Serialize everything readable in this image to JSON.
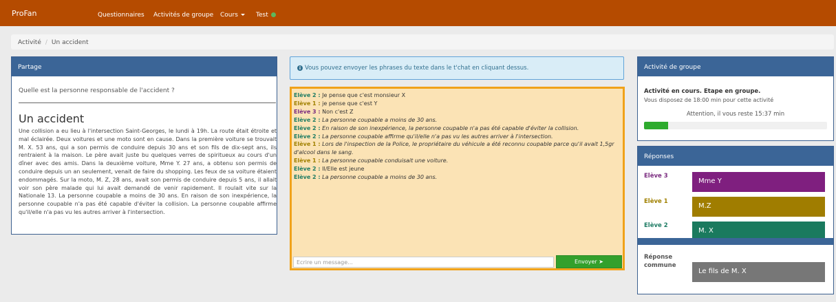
{
  "nav": {
    "brand": "ProFan",
    "items": [
      {
        "label": "Questionnaires"
      },
      {
        "label": "Activités de groupe"
      },
      {
        "label": "Cours"
      },
      {
        "label": "Test"
      }
    ]
  },
  "breadcrumb": {
    "root": "Activité",
    "current": "Un accident"
  },
  "partage": {
    "heading": "Partage",
    "question": "Quelle est la personne responsable de l'accident ?",
    "story_title": "Un accident",
    "story_text": "Une collision a eu lieu à l'intersection Saint-Georges, le lundi à 19h. La route était étroite et mal éclairée. Deux voitures et une moto sont en cause. Dans la première voiture se trouvait M. X. 53 ans, qui a son permis de conduire depuis 30 ans et son fils de dix-sept ans, ils rentraient à la maison. Le père avait juste bu quelques verres de spiritueux au cours d'un dîner avec des amis. Dans la deuxième voiture, Mme Y. 27 ans, a obtenu son permis de conduire depuis un an seulement, venait de faire du shopping. Les feux de sa voiture étaient endommagés. Sur la moto, M. Z, 28 ans, avait son permis de conduire depuis 5 ans, il allait voir son père malade qui lui avait demandé de venir rapidement. Il roulait vite sur la Nationale 13. La personne coupable a moins de 30 ans. En raison de son inexpérience, la personne coupable n'a pas été capable d'éviter la collision. La personne coupable affirme qu'il/elle n'a pas vu les autres arriver à l'intersection."
  },
  "info": {
    "text": "Vous pouvez envoyer les phrases du texte dans le t'chat en cliquant dessus."
  },
  "chat": {
    "messages": [
      {
        "speaker": "Elève 2 :",
        "text": "Je pense que c'est monsieur X",
        "italic": false,
        "color": "#1e7c64"
      },
      {
        "speaker": "Elève 1 :",
        "text": "je pense que c'est Y",
        "italic": false,
        "color": "#a08000"
      },
      {
        "speaker": "Elève 3 :",
        "text": "Non c'est Z",
        "italic": false,
        "color": "#7b2c80"
      },
      {
        "speaker": "Elève 2 :",
        "text": "La personne coupable a moins de 30 ans.",
        "italic": true,
        "color": "#1e7c64"
      },
      {
        "speaker": "Elève 2 :",
        "text": "En raison de son inexpérience, la personne coupable n'a pas été capable d'éviter la collision.",
        "italic": true,
        "color": "#1e7c64"
      },
      {
        "speaker": "Elève 2 :",
        "text": "La personne coupable affirme qu'il/elle n'a pas vu les autres arriver à l'intersection.",
        "italic": true,
        "color": "#1e7c64"
      },
      {
        "speaker": "Elève 1 :",
        "text": "Lors de l'inspection de la Police, le propriétaire du véhicule a été reconnu coupable parce qu'il avait 1,5gr d'alcool dans le sang.",
        "italic": true,
        "color": "#a08000"
      },
      {
        "speaker": "Elève 1 :",
        "text": "La personne coupable conduisait une voiture.",
        "italic": true,
        "color": "#a08000"
      },
      {
        "speaker": "Elève 2 :",
        "text": "Il/Elle est jeune",
        "italic": false,
        "color": "#1e7c64"
      },
      {
        "speaker": "Elève 2 :",
        "text": "La personne coupable a moins de 30 ans.",
        "italic": true,
        "color": "#1e7c64"
      }
    ],
    "input_placeholder": "Ecrire un message...",
    "send_label": "Envoyer"
  },
  "activity": {
    "heading": "Activité de groupe",
    "status": "Activité en cours. Etape en groupe.",
    "desc": "Vous disposez de 18:00 min pour cette activité",
    "attention": "Attention, il vous reste 15:37 min",
    "progress_fraction": 0.13
  },
  "responses": {
    "heading": "Réponses",
    "items": [
      {
        "label": "Elève 3",
        "value": "Mme Y",
        "label_color": "#7b2c80",
        "box_color": "#7f1f7f"
      },
      {
        "label": "Elève 1",
        "value": "M.Z",
        "label_color": "#a08000",
        "box_color": "#a07d00"
      },
      {
        "label": "Elève 2",
        "value": "M. X",
        "label_color": "#1e7c64",
        "box_color": "#1a7a5e"
      }
    ],
    "common_label": "Réponse commune",
    "common_value": "Le fils de M. X",
    "common_color": "#777777"
  }
}
